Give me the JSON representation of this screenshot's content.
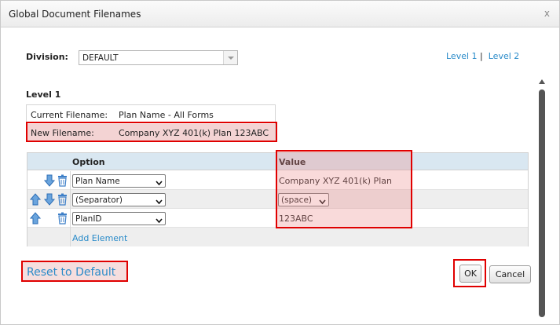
{
  "dialog": {
    "title": "Global Document Filenames",
    "close_glyph": "x"
  },
  "division": {
    "label": "Division:",
    "value": "DEFAULT"
  },
  "levels": {
    "level1": "Level 1",
    "separator": "|",
    "level2": "Level 2"
  },
  "section": {
    "heading": "Level 1"
  },
  "filenames": {
    "current_label": "Current Filename:",
    "current_value": "Plan Name - All Forms",
    "new_label": "New Filename:",
    "new_value": "Company XYZ 401(k) Plan 123ABC"
  },
  "table": {
    "headers": {
      "option": "Option",
      "value": "Value"
    },
    "rows": [
      {
        "option": "Plan Name",
        "value": "Company XYZ 401(k) Plan",
        "icons": [
          "arrow-down-icon",
          "trash-icon"
        ]
      },
      {
        "option": "(Separator)",
        "value": "(space)",
        "icons": [
          "arrow-up-icon",
          "arrow-down-icon",
          "trash-icon"
        ]
      },
      {
        "option": "PlanID",
        "value": "123ABC",
        "icons": [
          "arrow-up-icon",
          "trash-icon"
        ]
      }
    ],
    "add_label": "Add Element"
  },
  "actions": {
    "reset": "Reset to Default",
    "ok": "OK",
    "cancel": "Cancel"
  },
  "colors": {
    "link": "#2a8bc9",
    "header_bg": "#d9e7f1",
    "highlight_border": "#e00000",
    "arrow_icon": "#3d7fc8"
  }
}
